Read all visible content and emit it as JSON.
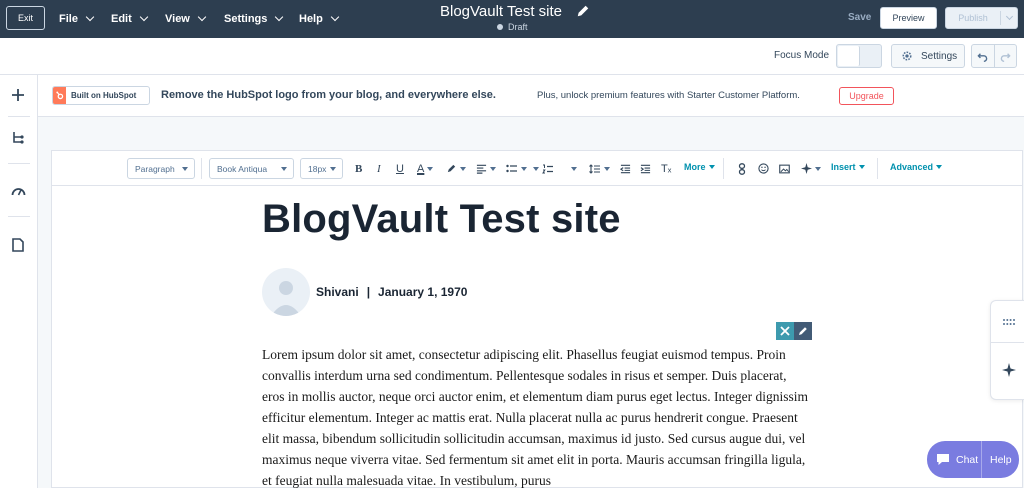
{
  "topbar": {
    "exit_label": "Exit",
    "menus": [
      "File",
      "Edit",
      "View",
      "Settings",
      "Help"
    ],
    "doc_title": "BlogVault Test site",
    "doc_status": "Draft",
    "save_label": "Save",
    "preview_label": "Preview",
    "publish_label": "Publish"
  },
  "secondbar": {
    "focus_mode_label": "Focus Mode",
    "settings_label": "Settings"
  },
  "banner": {
    "badge_label": "Built on HubSpot",
    "main_text": "Remove the HubSpot logo from your blog, and everywhere else.",
    "sub_text": "Plus, unlock premium features with Starter Customer Platform.",
    "upgrade_label": "Upgrade"
  },
  "toolbar": {
    "paragraph": "Paragraph",
    "font": "Book Antiqua",
    "size": "18px",
    "more_label": "More",
    "insert_label": "Insert",
    "advanced_label": "Advanced"
  },
  "post": {
    "title": "BlogVault Test site",
    "author": "Shivani",
    "separator": "|",
    "date": "January 1, 1970",
    "body": "Lorem ipsum dolor sit amet, consectetur adipiscing elit. Phasellus feugiat euismod tempus. Proin convallis interdum urna sed condimentum. Pellentesque sodales in risus et semper. Duis placerat, eros in mollis auctor, neque orci auctor enim, et elementum diam purus eget lectus. Integer dignissim efficitur elementum. Integer ac mattis erat. Nulla placerat nulla ac purus hendrerit congue. Praesent elit massa, bibendum sollicitudin sollicitudin accumsan, maximus id justo. Sed cursus augue dui, vel maximus neque viverra vitae. Sed fermentum sit amet elit in porta. Mauris accumsan fringilla ligula, et feugiat nulla malesuada vitae. In vestibulum, purus"
  },
  "chat": {
    "chat_label": "Chat",
    "help_label": "Help"
  },
  "colors": {
    "topbar": "#2d3e50",
    "hubspot_orange": "#ff7a59",
    "upgrade_red": "#f2545b",
    "link_teal": "#0091ae",
    "chat_purple": "#7a7ce0"
  }
}
